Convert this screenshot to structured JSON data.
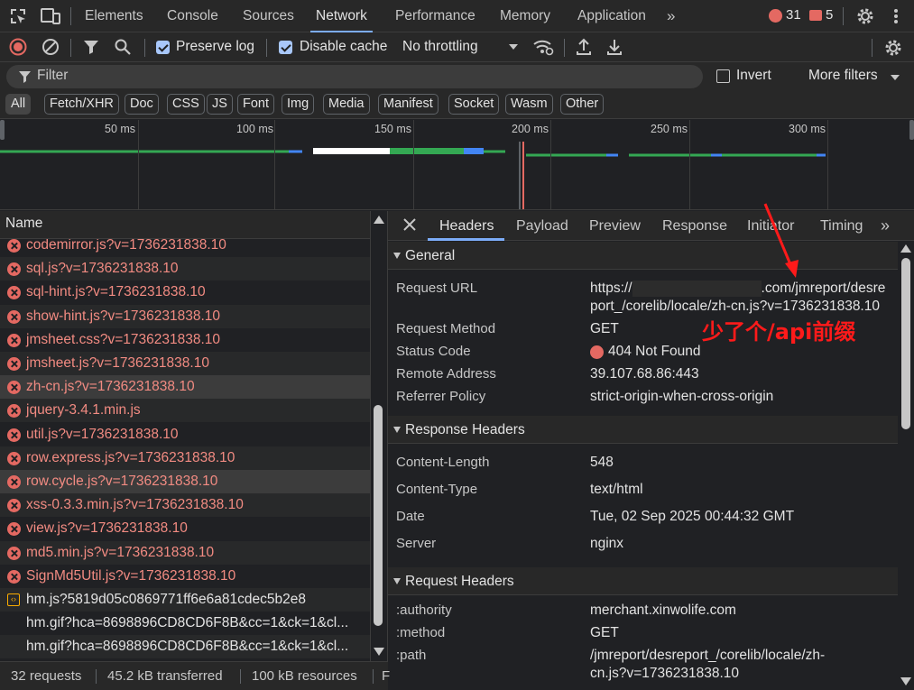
{
  "tabs": [
    {
      "label": "Elements"
    },
    {
      "label": "Console"
    },
    {
      "label": "Sources"
    },
    {
      "label": "Network"
    },
    {
      "label": "Performance"
    },
    {
      "label": "Memory"
    },
    {
      "label": "Application"
    }
  ],
  "counts": {
    "errors": "31",
    "issues": "5"
  },
  "toolbar": {
    "preserve_log": "Preserve log",
    "disable_cache": "Disable cache",
    "throttling": "No throttling"
  },
  "filter": {
    "placeholder": "Filter",
    "invert": "Invert",
    "more_filters": "More filters"
  },
  "chips": [
    "All",
    "Fetch/XHR",
    "Doc",
    "CSS",
    "JS",
    "Font",
    "Img",
    "Media",
    "Manifest",
    "Socket",
    "Wasm",
    "Other"
  ],
  "timeline": {
    "ticks": [
      "50 ms",
      "100 ms",
      "150 ms",
      "200 ms",
      "250 ms",
      "300 ms"
    ]
  },
  "list": {
    "header": "Name",
    "rows": [
      {
        "name": "codemirror.js?v=1736231838.10",
        "status": "error"
      },
      {
        "name": "sql.js?v=1736231838.10",
        "status": "error"
      },
      {
        "name": "sql-hint.js?v=1736231838.10",
        "status": "error"
      },
      {
        "name": "show-hint.js?v=1736231838.10",
        "status": "error"
      },
      {
        "name": "jmsheet.css?v=1736231838.10",
        "status": "error"
      },
      {
        "name": "jmsheet.js?v=1736231838.10",
        "status": "error"
      },
      {
        "name": "zh-cn.js?v=1736231838.10",
        "status": "error"
      },
      {
        "name": "jquery-3.4.1.min.js",
        "status": "error"
      },
      {
        "name": "util.js?v=1736231838.10",
        "status": "error"
      },
      {
        "name": "row.express.js?v=1736231838.10",
        "status": "error"
      },
      {
        "name": "row.cycle.js?v=1736231838.10",
        "status": "error"
      },
      {
        "name": "xss-0.3.3.min.js?v=1736231838.10",
        "status": "error"
      },
      {
        "name": "view.js?v=1736231838.10",
        "status": "error"
      },
      {
        "name": "md5.min.js?v=1736231838.10",
        "status": "error"
      },
      {
        "name": "SignMd5Util.js?v=1736231838.10",
        "status": "error"
      },
      {
        "name": "hm.js?5819d05c0869771ff6e6a81cdec5b2e8",
        "status": "script"
      },
      {
        "name": "hm.gif?hca=8698896CD8CD6F8B&cc=1&ck=1&cl...",
        "status": "ok"
      },
      {
        "name": "hm.gif?hca=8698896CD8CD6F8B&cc=1&ck=1&cl...",
        "status": "ok"
      }
    ]
  },
  "status": {
    "requests": "32 requests",
    "transferred": "45.2 kB transferred",
    "resources": "100 kB resources",
    "cut": "F"
  },
  "details": {
    "tabs": [
      "Headers",
      "Payload",
      "Preview",
      "Response",
      "Initiator",
      "Timing"
    ],
    "general": {
      "title": "General",
      "request_url_key": "Request URL",
      "request_url_a": "https://",
      "request_url_b": ".com/jmreport/desre",
      "request_url_c": "port_/corelib/locale/zh-cn.js?v=1736231838.10",
      "method_key": "Request Method",
      "method": "GET",
      "status_key": "Status Code",
      "status": "404 Not Found",
      "remote_key": "Remote Address",
      "remote": "39.107.68.86:443",
      "referrer_key": "Referrer Policy",
      "referrer": "strict-origin-when-cross-origin"
    },
    "response": {
      "title": "Response Headers",
      "items": [
        {
          "k": "Content-Length",
          "v": "548"
        },
        {
          "k": "Content-Type",
          "v": "text/html"
        },
        {
          "k": "Date",
          "v": "Tue, 02 Sep 2025 00:44:32 GMT"
        },
        {
          "k": "Server",
          "v": "nginx"
        }
      ]
    },
    "request": {
      "title": "Request Headers",
      "authority_key": ":authority",
      "authority": "merchant.xinwolife.com",
      "method_key": ":method",
      "method": "GET",
      "path_key": ":path",
      "path_a": "/jmreport/desreport_/corelib/locale/zh-",
      "path_b": "cn.js?v=1736231838.10"
    }
  },
  "annotation": "少了个/api前缀",
  "colors": {
    "accent": "#7cacf8",
    "error": "#f28b82",
    "annotation": "#ff1a1a"
  }
}
